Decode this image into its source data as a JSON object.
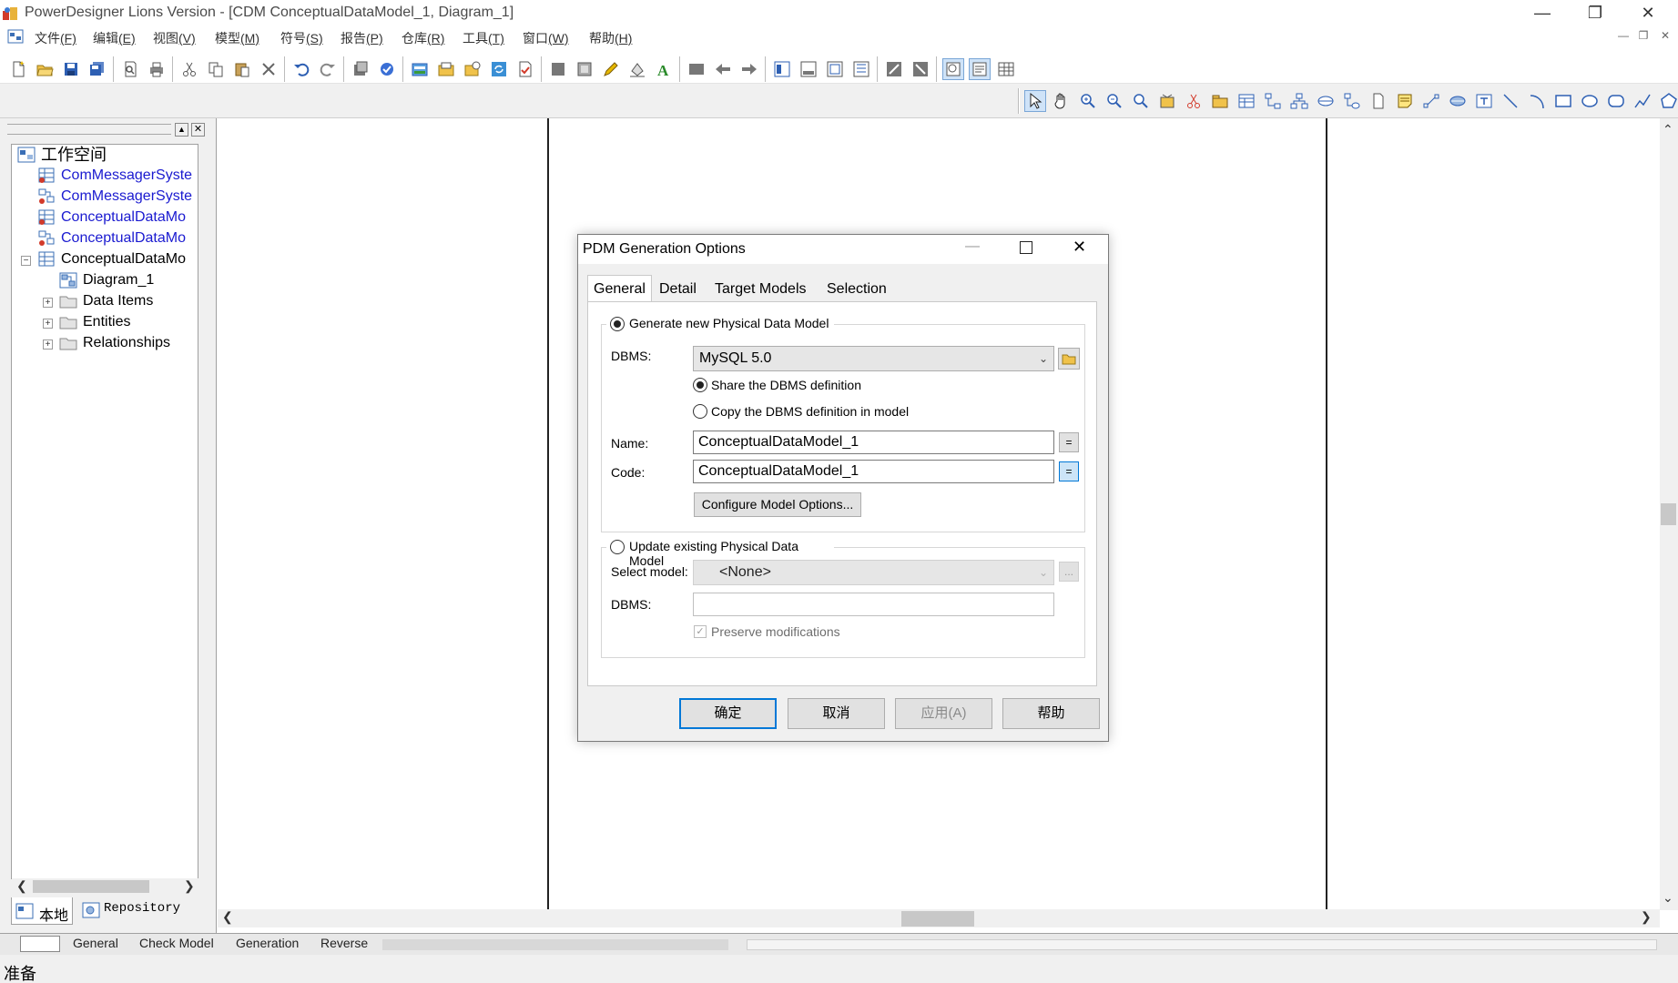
{
  "window": {
    "title": "PowerDesigner Lions Version - [CDM ConceptualDataModel_1, Diagram_1]"
  },
  "menu": [
    {
      "label": "文件",
      "key": "(F)"
    },
    {
      "label": "编辑",
      "key": "(E)"
    },
    {
      "label": "视图",
      "key": "(V)"
    },
    {
      "label": "模型",
      "key": "(M)"
    },
    {
      "label": "符号",
      "key": "(S)"
    },
    {
      "label": "报告",
      "key": "(P)"
    },
    {
      "label": "仓库",
      "key": "(R)"
    },
    {
      "label": "工具",
      "key": "(T)"
    },
    {
      "label": "窗口",
      "key": "(W)"
    },
    {
      "label": "帮助",
      "key": "(H)"
    }
  ],
  "browser": {
    "root": "工作空间",
    "items": [
      {
        "label": "ComMessagerSyste",
        "icon": "cdm-model-icon",
        "color": "#1a1ad0"
      },
      {
        "label": "ComMessagerSyste",
        "icon": "pdm-model-icon",
        "color": "#1a1ad0"
      },
      {
        "label": "ConceptualDataMo",
        "icon": "cdm-model-icon",
        "color": "#1a1ad0"
      },
      {
        "label": "ConceptualDataMo",
        "icon": "pdm-model-icon",
        "color": "#1a1ad0"
      },
      {
        "label": "ConceptualDataMo",
        "icon": "cdm-model-icon",
        "color": "#000000"
      }
    ],
    "children": [
      {
        "label": "Diagram_1",
        "icon": "diagram-icon"
      },
      {
        "label": "Data Items",
        "icon": "folder-icon"
      },
      {
        "label": "Entities",
        "icon": "folder-icon"
      },
      {
        "label": "Relationships",
        "icon": "folder-icon"
      }
    ],
    "tabs": {
      "local": "本地",
      "repository": "Repository"
    }
  },
  "output_tabs": [
    "General",
    "Check Model",
    "Generation",
    "Reverse"
  ],
  "status": "准备",
  "dialog": {
    "title": "PDM Generation Options",
    "tabs": [
      "General",
      "Detail",
      "Target Models",
      "Selection"
    ],
    "active_tab": "General",
    "generate_new": {
      "label": "Generate new Physical Data Model",
      "selected": true,
      "dbms_label": "DBMS:",
      "dbms_value": "MySQL 5.0",
      "share_label": "Share the DBMS definition",
      "copy_label": "Copy the DBMS definition in model",
      "name_label": "Name:",
      "name_value": "ConceptualDataModel_1",
      "code_label": "Code:",
      "code_value": "ConceptualDataModel_1",
      "equals": "=",
      "configure_button": "Configure Model Options..."
    },
    "update_existing": {
      "label": "Update existing Physical Data Model",
      "selected": false,
      "select_model_label": "Select model:",
      "select_model_value": "<None>",
      "dbms_label": "DBMS:",
      "dbms_value": "",
      "browse": "...",
      "preserve_label": "Preserve modifications",
      "preserve_checked": true
    },
    "buttons": {
      "ok": "确定",
      "cancel": "取消",
      "apply": "应用(A)",
      "help": "帮助"
    }
  },
  "colors": {
    "accent": "#0078d7",
    "link": "#1a1ad0"
  }
}
